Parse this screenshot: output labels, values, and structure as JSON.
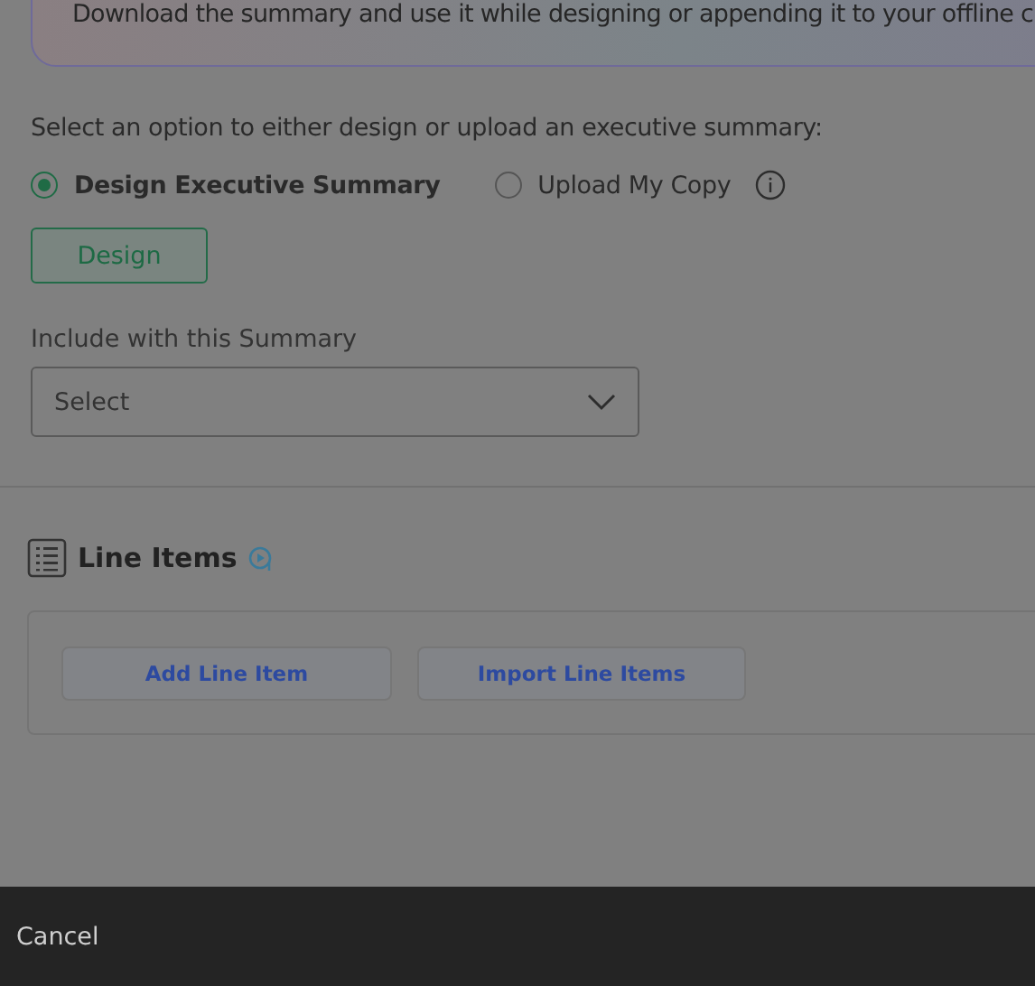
{
  "banner": {
    "text": "Download the summary and use it while designing or appending it to your offline c"
  },
  "summary": {
    "prompt": "Select an option to either design or upload an executive summary:",
    "options": [
      {
        "label": "Design Executive Summary",
        "selected": true,
        "info": false
      },
      {
        "label": "Upload My Copy",
        "selected": false,
        "info": true
      }
    ],
    "design_button": "Design",
    "include_label": "Include with this Summary",
    "include_placeholder": "Select"
  },
  "line_items": {
    "title": "Line Items",
    "buttons": [
      "Add Line Item",
      "Import Line Items"
    ]
  },
  "footer": {
    "cancel": "Cancel"
  }
}
